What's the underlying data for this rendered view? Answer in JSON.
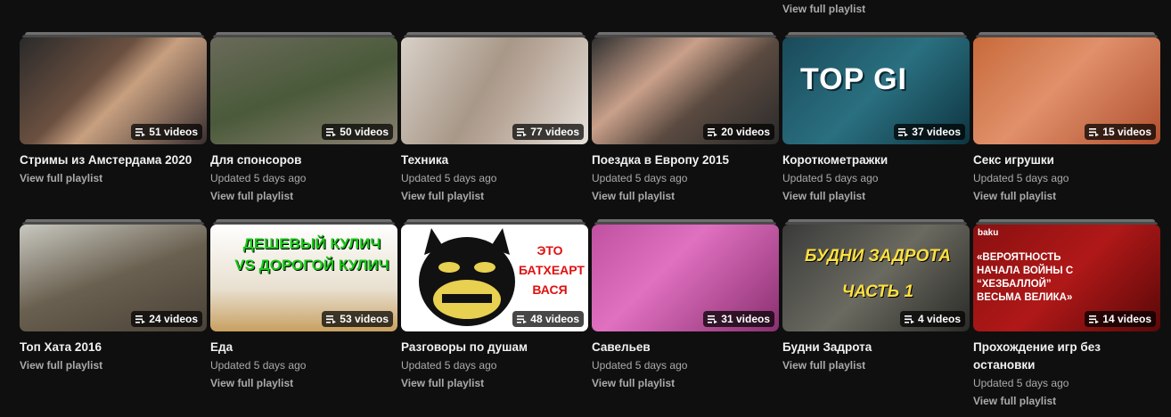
{
  "top_link": "View full playlist",
  "playlists": [
    {
      "title": "Стримы из Амстердама 2020",
      "count": "51 videos",
      "updated": "",
      "link": "View full playlist",
      "bg": "linear-gradient(135deg,#2a2a2a 0%,#6b5040 40%,#c8a080 55%,#3a3030 100%)"
    },
    {
      "title": "Для спонсоров",
      "count": "50 videos",
      "updated": "Updated 5 days ago",
      "link": "View full playlist",
      "bg": "linear-gradient(160deg,#6a6a5a 0%,#4a5a3a 50%,#8a8070 100%)"
    },
    {
      "title": "Техника",
      "count": "77 videos",
      "updated": "Updated 5 days ago",
      "link": "View full playlist",
      "bg": "linear-gradient(120deg,#d8d0c8 0%,#a89888 45%,#b9a89a 60%,#e6e0da 100%)"
    },
    {
      "title": "Поездка в Европу 2015",
      "count": "20 videos",
      "updated": "Updated 5 days ago",
      "link": "View full playlist",
      "bg": "linear-gradient(140deg,#303030 0%,#c9a08a 35%,#5a4a40 60%,#2a2a2a 100%)"
    },
    {
      "title": "Короткометражки",
      "count": "37 videos",
      "updated": "Updated 5 days ago",
      "link": "View full playlist",
      "bg": "linear-gradient(135deg,#1a4a5a 0%,#2a7080 50%,#0e3440 100%)",
      "overlay": "TOP GI"
    },
    {
      "title": "Секс игрушки",
      "count": "15 videos",
      "updated": "Updated 5 days ago",
      "link": "View full playlist",
      "bg": "linear-gradient(135deg,#c86a3a 0%,#e0906a 45%,#b05030 100%)"
    },
    {
      "title": "Топ Хата 2016",
      "count": "24 videos",
      "updated": "",
      "link": "View full playlist",
      "bg": "linear-gradient(160deg,#c8c8c0 0%,#6a6050 50%,#4a4238 100%)"
    },
    {
      "title": "Еда",
      "count": "53 videos",
      "updated": "Updated 5 days ago",
      "link": "View full playlist",
      "bg": "linear-gradient(180deg,#ffffff 0%,#e8e0d0 60%,#c8a060 100%)",
      "overlay": "ДЕШЕВЫЙ КУЛИЧ VS ДОРОГОЙ КУЛИЧ"
    },
    {
      "title": "Разговоры по душам",
      "count": "48 videos",
      "updated": "Updated 5 days ago",
      "link": "View full playlist",
      "bg": "#ffffff",
      "overlay": "ЭТО БАТХЕАРТ ВАСЯ"
    },
    {
      "title": "Савельев",
      "count": "31 videos",
      "updated": "Updated 5 days ago",
      "link": "View full playlist",
      "bg": "linear-gradient(135deg,#c050a0 0%,#e070c0 40%,#8a3070 100%)"
    },
    {
      "title": "Будни Задрота",
      "count": "4 videos",
      "updated": "",
      "link": "View full playlist",
      "bg": "linear-gradient(135deg,#3a3a3a 0%,#6a6a60 50%,#2a2a28 100%)",
      "overlay": "БУДНИ ЗАДРОТА ЧАСТЬ 1"
    },
    {
      "title": "Прохождение игр без остановки",
      "count": "14 videos",
      "updated": "Updated 5 days ago",
      "link": "View full playlist",
      "bg": "linear-gradient(135deg,#8a1010 0%,#b01818 50%,#5a0808 100%)",
      "overlay": "«ВЕРОЯТНОСТЬ НАЧАЛА ВОЙНЫ С “ХЕЗБАЛЛОЙ” ВЕСЬМА ВЕЛИКА»",
      "brand": "baku"
    }
  ]
}
